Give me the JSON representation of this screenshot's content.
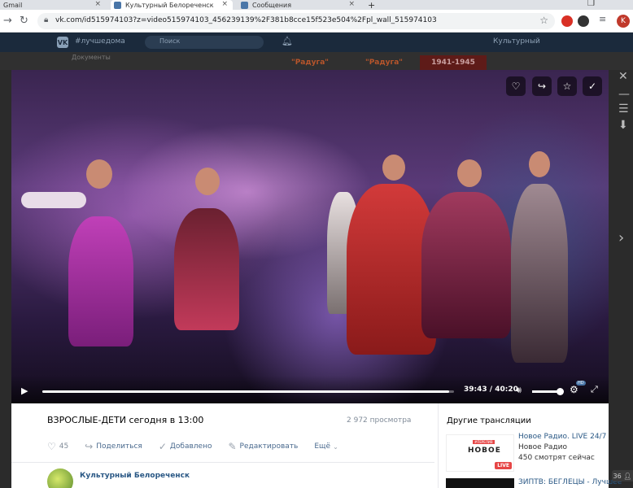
{
  "browser": {
    "tabs": [
      {
        "label": "Gmail",
        "active": false
      },
      {
        "label": "Культурный Белореченск",
        "active": true
      },
      {
        "label": "Сообщения",
        "active": false
      }
    ],
    "new_tab": "+",
    "url": "vk.com/id515974103?z=video515974103_456239139%2F381b8cce15f523e504%2Fpl_wall_515974103",
    "profile_initial": "K"
  },
  "vk_header": {
    "hashtag": "#лучшедома",
    "search_placeholder": "Поиск",
    "user_name": "Культурный"
  },
  "background": {
    "docs_label": "Документы",
    "banners": [
      "\"Радуга\"",
      "\"Радуга\"",
      "1941-1945"
    ]
  },
  "player": {
    "progress": 0.988,
    "time_current": "39:43",
    "time_total": "40:20",
    "volume": 1.0,
    "quality_badge": "HD"
  },
  "video": {
    "title": "ВЗРОСЛЫЕ-ДЕТИ сегодня в 13:00",
    "views": "2 972 просмотра",
    "likes": "45",
    "actions": {
      "share": "Поделиться",
      "added": "Добавлено",
      "edit": "Редактировать",
      "more": "Ещё"
    },
    "channel": "Культурный Белореченск"
  },
  "related": {
    "title": "Другие трансляции",
    "items": [
      {
        "name": "Новое Радио. LIVE 24/7",
        "author": "Новое Радио",
        "watching": "450 смотрят сейчас",
        "brand": "НОВОЕ",
        "live": "LIVE",
        "tag": "#ПЕРЕЛИВ"
      },
      {
        "name": "ЗИПТВ: БЕГЛЕЦЫ - Лучшее"
      }
    ]
  },
  "counter": "36"
}
